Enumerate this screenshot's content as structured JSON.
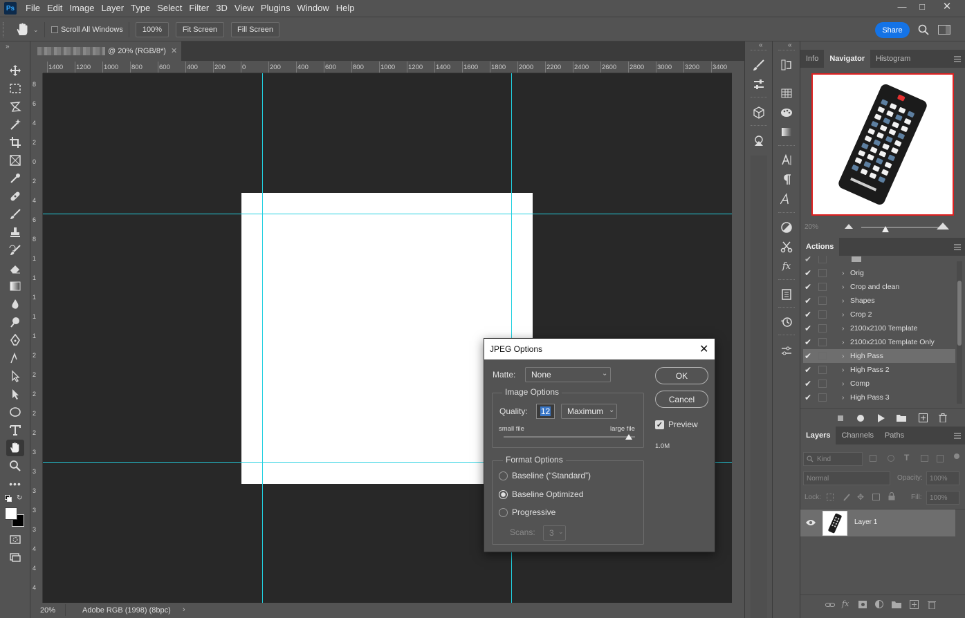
{
  "app": {
    "logo": "Ps",
    "menu": [
      "File",
      "Edit",
      "Image",
      "Layer",
      "Type",
      "Select",
      "Filter",
      "3D",
      "View",
      "Plugins",
      "Window",
      "Help"
    ]
  },
  "optionsbar": {
    "scroll_all_windows": "Scroll All Windows",
    "zoom_100": "100%",
    "fit_screen": "Fit Screen",
    "fill_screen": "Fill Screen",
    "share": "Share"
  },
  "document": {
    "tab_title": "@ 20% (RGB/8*)",
    "ruler_h": [
      "1400",
      "1200",
      "1000",
      "800",
      "600",
      "400",
      "200",
      "0",
      "200",
      "400",
      "600",
      "800",
      "1000",
      "1200",
      "1400",
      "1600",
      "1800",
      "2000",
      "2200",
      "2400",
      "2600",
      "2800",
      "3000",
      "3200",
      "3400"
    ],
    "ruler_v": [
      "8",
      "6",
      "4",
      "2",
      "0",
      "2",
      "4",
      "6",
      "8",
      "1",
      "1",
      "1",
      "1",
      "1",
      "2",
      "2",
      "2",
      "2",
      "2",
      "3",
      "3",
      "3",
      "3",
      "3",
      "4",
      "4",
      "4",
      "4"
    ],
    "status_zoom": "20%",
    "status_profile": "Adobe RGB (1998) (8bpc)"
  },
  "panels": {
    "top_tabs": [
      "Info",
      "Navigator",
      "Histogram"
    ],
    "navigator_zoom": "20%",
    "actions_tab": "Actions",
    "actions": [
      "Orig",
      "Crop and clean",
      "Shapes",
      "Crop 2",
      "2100x2100 Template",
      "2100x2100 Template Only",
      "High Pass",
      "High Pass 2",
      "Comp",
      "High Pass 3"
    ],
    "selected_action": "High Pass",
    "layer_tabs": [
      "Layers",
      "Channels",
      "Paths"
    ],
    "kind_filter": "Kind",
    "blend_mode": "Normal",
    "opacity_label": "Opacity:",
    "opacity_value": "100%",
    "lock_label": "Lock:",
    "fill_label": "Fill:",
    "fill_value": "100%",
    "layer_name": "Layer 1"
  },
  "dialog": {
    "title": "JPEG Options",
    "matte_label": "Matte:",
    "matte_value": "None",
    "image_options": "Image Options",
    "quality_label": "Quality:",
    "quality_value": "12",
    "quality_preset": "Maximum",
    "small_file": "small file",
    "large_file": "large file",
    "quality_slider_fraction": 1.0,
    "format_options": "Format Options",
    "format_choices": [
      "Baseline (“Standard”)",
      "Baseline Optimized",
      "Progressive"
    ],
    "format_selected": "Baseline Optimized",
    "scans_label": "Scans:",
    "scans_value": "3",
    "ok": "OK",
    "cancel": "Cancel",
    "preview_label": "Preview",
    "preview_checked": true,
    "file_size": "1.0M"
  },
  "colors": {
    "guide": "#22d0e0",
    "share": "#1473e6",
    "nav_view_box": "#e02020"
  }
}
